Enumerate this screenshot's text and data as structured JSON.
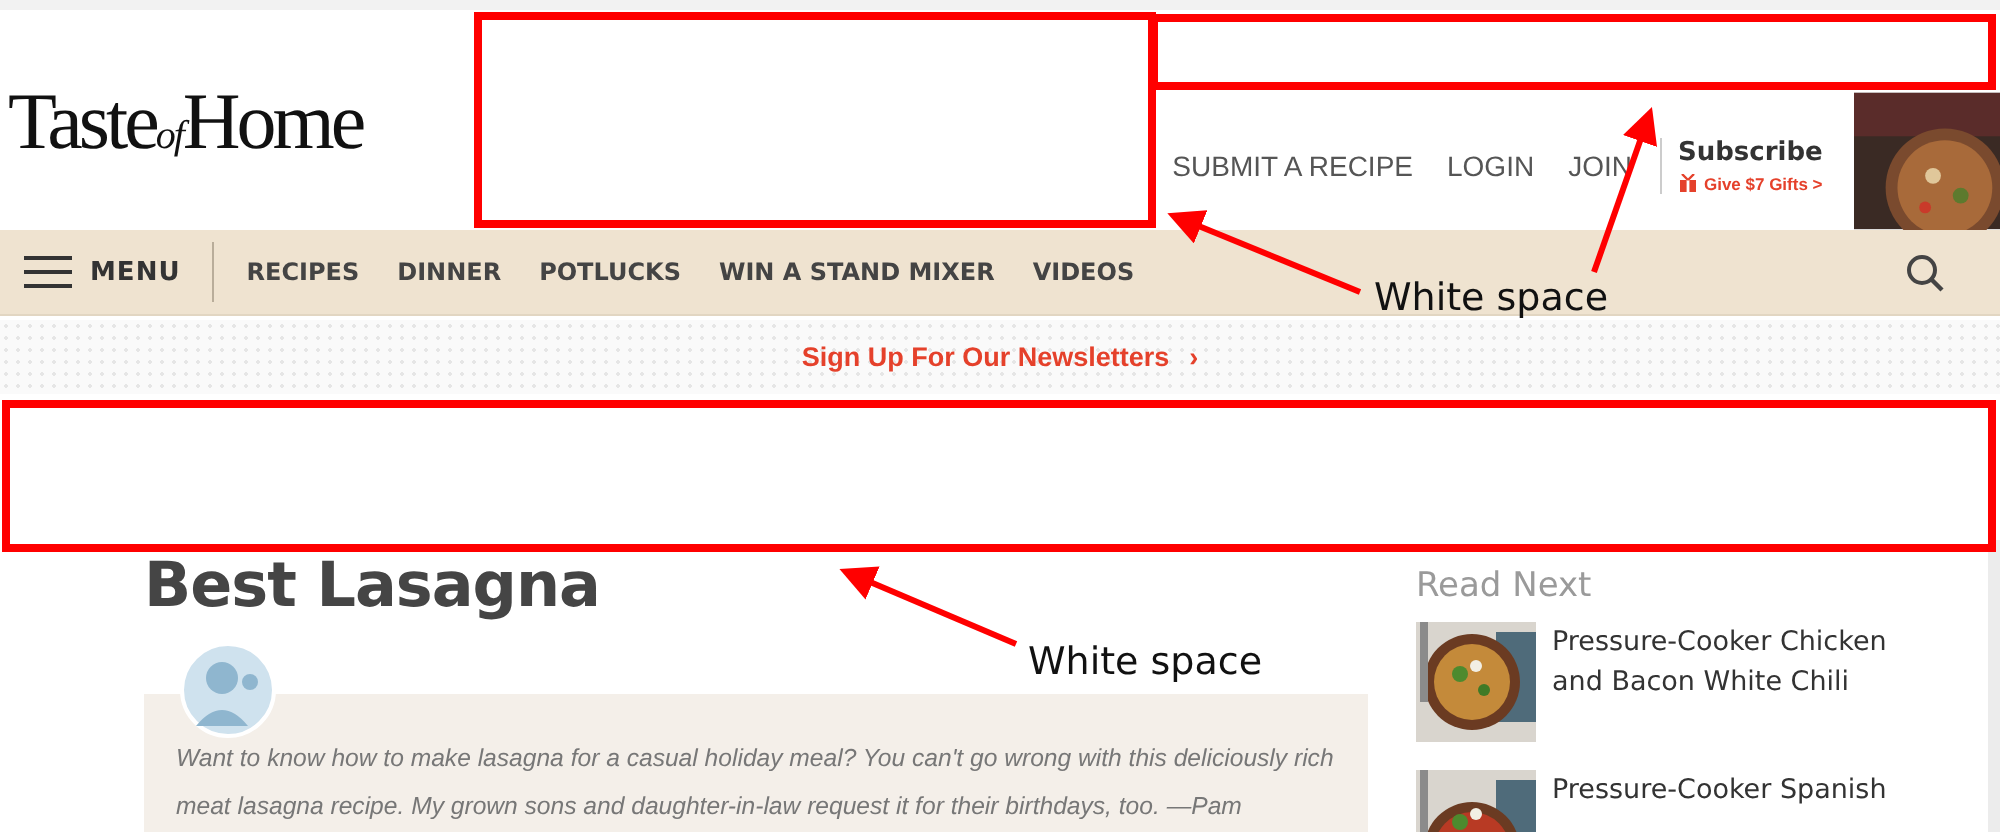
{
  "header": {
    "logo": {
      "start": "Taste",
      "small": "of",
      "end": "Home"
    },
    "links": [
      {
        "label": "SUBMIT A RECIPE"
      },
      {
        "label": "LOGIN"
      },
      {
        "label": "JOIN"
      }
    ],
    "subscribe": {
      "title": "Subscribe",
      "offer": "Give $7 Gifts >"
    }
  },
  "nav": {
    "menu": "MENU",
    "items": [
      {
        "label": "RECIPES"
      },
      {
        "label": "DINNER"
      },
      {
        "label": "POTLUCKS"
      },
      {
        "label": "WIN A STAND MIXER"
      },
      {
        "label": "VIDEOS"
      }
    ]
  },
  "newsletter": {
    "label": "Sign Up For Our Newsletters",
    "chevron": "›"
  },
  "article": {
    "title": "Best Lasagna",
    "intro": "Want to know how to make lasagna for a casual holiday meal? You can't go wrong with this deliciously rich meat lasagna recipe. My grown sons and daughter-in-law request it for their birthdays, too. —Pam"
  },
  "read_next": {
    "heading": "Read Next",
    "items": [
      {
        "title": "Pressure-Cooker Chicken and Bacon White Chili"
      },
      {
        "title": "Pressure-Cooker Spanish"
      }
    ]
  },
  "annotations": [
    {
      "label": "White space"
    },
    {
      "label": "White space"
    }
  ]
}
